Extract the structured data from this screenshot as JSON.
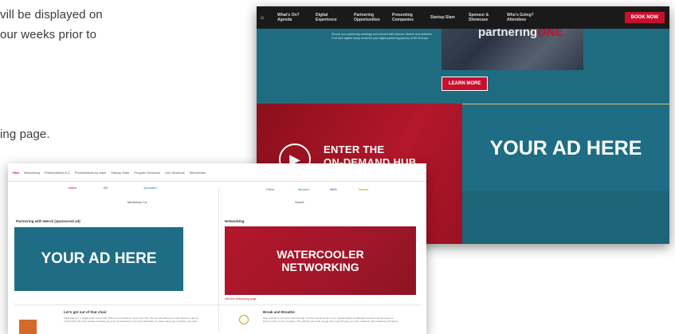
{
  "background_text": {
    "line1": "vill be displayed on",
    "line2": "our weeks prior to",
    "line3": "ing page."
  },
  "event_site": {
    "nav": {
      "home_icon": "home-icon",
      "items": [
        {
          "label": "What's On? Agenda"
        },
        {
          "label": "Digital Experience"
        },
        {
          "label": "Partnering Opportunities"
        },
        {
          "label": "Presenting Companies"
        },
        {
          "label": "Startup Slam"
        },
        {
          "label": "Sponsor & Showcase"
        },
        {
          "label": "Who's Going? Attendees"
        }
      ],
      "book_now": "BOOK NOW"
    },
    "hero": {
      "text": "Secure your partnering meetings and connect with pharma, biotech and investors. Find and register today to launch your digital partnering journey at BIO-Europe",
      "brand_main": "partnering",
      "brand_accent": "ONE",
      "learn_more": "LEARN MORE"
    },
    "hub": {
      "line1": "ENTER THE",
      "line2": "ON-DEMAND HUB"
    },
    "ad": "YOUR AD HERE"
  },
  "hub_page": {
    "tabs": [
      {
        "label": "Hub",
        "active": true
      },
      {
        "label": "Networking"
      },
      {
        "label": "Presentations A-Z"
      },
      {
        "label": "Presentations by track"
      },
      {
        "label": "Startup Slam"
      },
      {
        "label": "Program Sessions"
      },
      {
        "label": "Live Sessions"
      },
      {
        "label": "Microbiome"
      }
    ],
    "logos_left": [
      "twitch",
      "BD",
      "Ypsomed",
      "Medicines Co."
    ],
    "logos_right": [
      "Pfizer",
      "Beyond",
      "BMS",
      "Servier",
      "Sanofi"
    ],
    "partnering_title": "Partnering with Merck (sponsored ad)",
    "ad": "YOUR AD HERE",
    "networking_title": "Networking",
    "watercooler_line1": "WATERCOOLER",
    "watercooler_line2": "NETWORKING",
    "networking_link": "Visit the Networking page",
    "card1_title": "Let's get out of that chair",
    "card1_text": "Participating in a digital event comes with sitting at your desk for most of the day. We are now offering you the chance to get out of that chair! We have started a workout group for all attendees to join and participate no matter what type of activity you prefer.",
    "card2_title": "Break and Breathe",
    "card2_text": "Take a break to de-stress and recharge. Join the virtual version of our popular Break and Breathe sessions and let pause to bring in fresh of your computer. This will help you build energy and to get through your busy schedule with breathing techniques."
  }
}
